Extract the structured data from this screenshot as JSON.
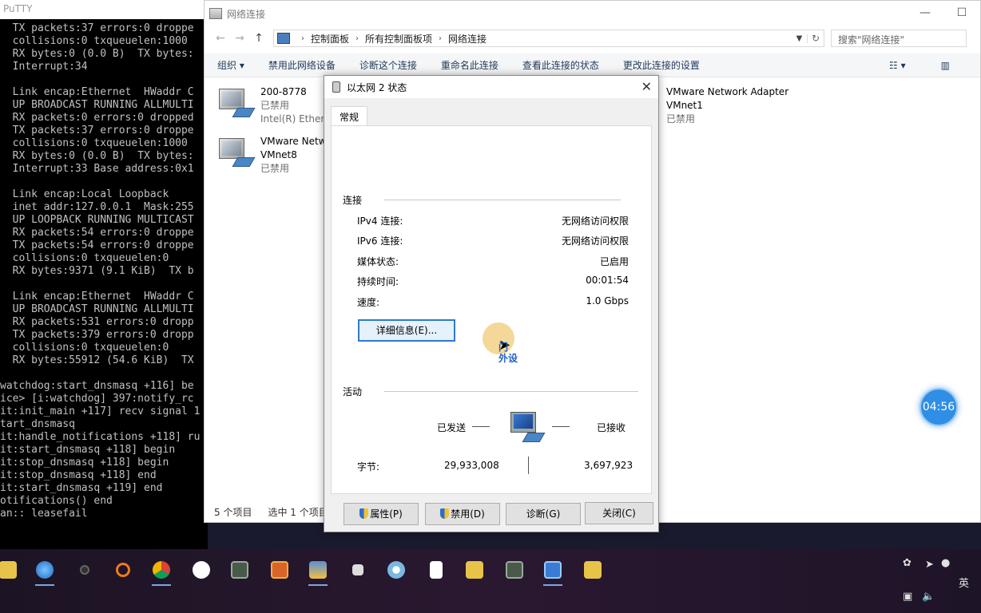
{
  "putty": {
    "title": "PuTTY",
    "lines": [
      "  TX packets:37 errors:0 droppe",
      "  collisions:0 txqueuelen:1000",
      "  RX bytes:0 (0.0 B)  TX bytes:",
      "  Interrupt:34",
      "",
      "  Link encap:Ethernet  HWaddr C",
      "  UP BROADCAST RUNNING ALLMULTI",
      "  RX packets:0 errors:0 dropped",
      "  TX packets:37 errors:0 droppe",
      "  collisions:0 txqueuelen:1000",
      "  RX bytes:0 (0.0 B)  TX bytes:",
      "  Interrupt:33 Base address:0x1",
      "",
      "  Link encap:Local Loopback",
      "  inet addr:127.0.0.1  Mask:255",
      "  UP LOOPBACK RUNNING MULTICAST",
      "  RX packets:54 errors:0 droppe",
      "  TX packets:54 errors:0 droppe",
      "  collisions:0 txqueuelen:0",
      "  RX bytes:9371 (9.1 KiB)  TX b",
      "",
      "  Link encap:Ethernet  HWaddr C",
      "  UP BROADCAST RUNNING ALLMULTI",
      "  RX packets:531 errors:0 dropp",
      "  TX packets:379 errors:0 dropp",
      "  collisions:0 txqueuelen:0",
      "  RX bytes:55912 (54.6 KiB)  TX",
      "",
      "watchdog:start_dnsmasq +116] be",
      "ice> [i:watchdog] 397:notify_rc",
      "it:init_main +117] recv signal 1",
      "tart_dnsmasq",
      "it:handle_notifications +118] ru",
      "it:start_dnsmasq +118] begin",
      "it:stop_dnsmasq +118] begin",
      "it:stop_dnsmasq +118] end",
      "it:start_dnsmasq +119] end",
      "otifications() end",
      "an:: leasefail"
    ]
  },
  "explorer": {
    "title": "网络连接",
    "window_controls": [
      "—",
      "☐"
    ],
    "nav": {
      "back": "←",
      "forward": "→",
      "up": "↑"
    },
    "breadcrumb": [
      "控制面板",
      "所有控制面板项",
      "网络连接"
    ],
    "search_placeholder": "搜索\"网络连接\"",
    "commands": [
      "组织 ▾",
      "禁用此网络设备",
      "诊断这个连接",
      "重命名此连接",
      "查看此连接的状态",
      "更改此连接的设置"
    ],
    "items": [
      {
        "name": "200-8778",
        "status": "已禁用",
        "device": "Intel(R) Etherne"
      },
      {
        "name": "VMware Netw",
        "status": "VMnet8",
        "device": "已禁用"
      },
      {
        "name": "VMware Network Adapter",
        "status": "VMnet1",
        "device": "已禁用"
      }
    ],
    "status_bar": {
      "count": "5 个项目",
      "selected": "选中 1 个项目"
    }
  },
  "dialog": {
    "title": "以太网 2 状态",
    "close": "✕",
    "tab": "常规",
    "connection_header": "连接",
    "rows": [
      {
        "label": "IPv4 连接:",
        "value": "无网络访问权限"
      },
      {
        "label": "IPv6 连接:",
        "value": "无网络访问权限"
      },
      {
        "label": "媒体状态:",
        "value": "已启用"
      },
      {
        "label": "持续时间:",
        "value": "00:01:54"
      },
      {
        "label": "速度:",
        "value": "1.0 Gbps"
      }
    ],
    "details_button": "详细信息(E)...",
    "activity_header": "活动",
    "sent_label": "已发送",
    "received_label": "已接收",
    "bytes_label": "字节:",
    "bytes_sent": "29,933,008",
    "bytes_received": "3,697,923",
    "buttons": {
      "properties": "属性(P)",
      "disable": "禁用(D)",
      "diagnose": "诊断(G)",
      "close": "关闭(C)"
    },
    "cursor_tooltip": "门\n外设"
  },
  "timer": "04:56",
  "taskbar": {
    "icons": [
      "file-explorer-icon",
      "network-globe-icon",
      "camera-icon",
      "search-app-icon",
      "chrome-icon",
      "media-player-icon",
      "terminal-icon",
      "app-icon",
      "network-tool-icon",
      "folder-icon",
      "settings-flower-icon",
      "document-icon",
      "search-folder-icon",
      "terminal-icon-2",
      "control-panel-icon",
      "search-folder-icon-2"
    ],
    "ime": "英"
  }
}
